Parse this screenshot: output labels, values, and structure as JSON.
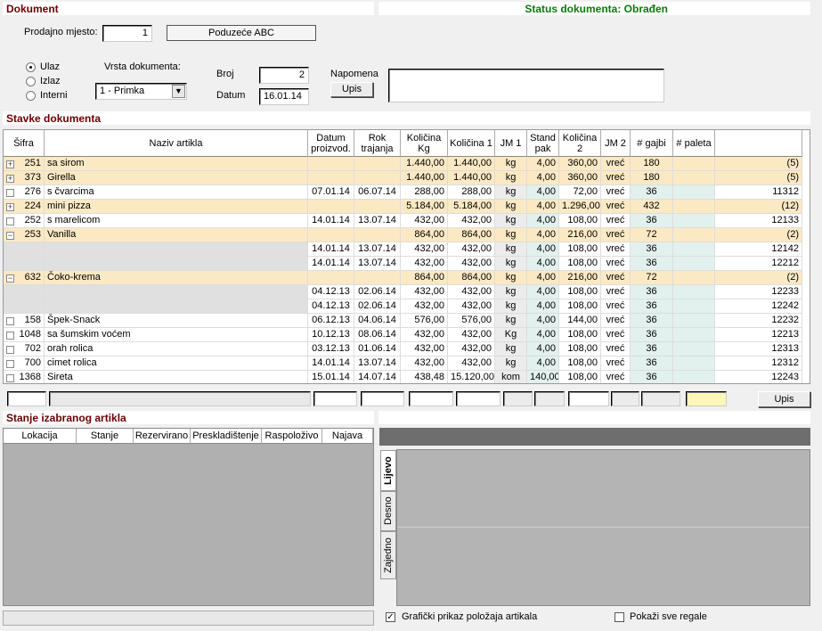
{
  "header": {
    "title": "Dokument",
    "status": "Status dokumenta: Obrađen"
  },
  "form": {
    "prodajno_mjesto_label": "Prodajno mjesto:",
    "prodajno_mjesto_value": "1",
    "company": "Poduzeće ABC",
    "direction": [
      "Ulaz",
      "Izlaz",
      "Interni"
    ],
    "direction_selected": "Ulaz",
    "vrsta_label": "Vrsta dokumenta:",
    "vrsta_value": "1 - Primka",
    "broj_label": "Broj",
    "broj_value": "2",
    "datum_label": "Datum",
    "datum_value": "16.01.14",
    "napomena_label": "Napomena",
    "upis_label": "Upis",
    "napomena_value": ""
  },
  "items_section": {
    "title": "Stavke dokumenta",
    "columns": [
      "Šifra",
      "Naziv artikla",
      "Datum proizvod.",
      "Rok trajanja",
      "Količina Kg",
      "Količina 1",
      "JM 1",
      "Stand pak",
      "Količina 2",
      "JM 2",
      "# gajbi",
      "# paleta",
      ""
    ],
    "rows": [
      {
        "kind": "group",
        "exp": "+",
        "sifra": "251",
        "naziv": "sa sirom",
        "dat": "",
        "rok": "",
        "kg": "1.440,00",
        "k1": "1.440,00",
        "jm1": "kg",
        "sp": "4,00",
        "k2": "360,00",
        "jm2": "vreć",
        "gaj": "180",
        "pal": "",
        "last": "(5)"
      },
      {
        "kind": "group",
        "exp": "+",
        "sifra": "373",
        "naziv": "Girella",
        "dat": "",
        "rok": "",
        "kg": "1.440,00",
        "k1": "1.440,00",
        "jm1": "kg",
        "sp": "4,00",
        "k2": "360,00",
        "jm2": "vreć",
        "gaj": "180",
        "pal": "",
        "last": "(5)"
      },
      {
        "kind": "item",
        "exp": "",
        "sifra": "276",
        "naziv": "s čvarcima",
        "dat": "07.01.14",
        "rok": "06.07.14",
        "kg": "288,00",
        "k1": "288,00",
        "jm1": "kg",
        "sp": "4,00",
        "k2": "72,00",
        "jm2": "vreć",
        "gaj": "36",
        "pal": "",
        "last": "11312"
      },
      {
        "kind": "group",
        "exp": "+",
        "sifra": "224",
        "naziv": "mini pizza",
        "dat": "",
        "rok": "",
        "kg": "5.184,00",
        "k1": "5.184,00",
        "jm1": "kg",
        "sp": "4,00",
        "k2": "1.296,00",
        "jm2": "vreć",
        "gaj": "432",
        "pal": "",
        "last": "(12)"
      },
      {
        "kind": "item",
        "exp": "",
        "sifra": "252",
        "naziv": "s marelicom",
        "dat": "14.01.14",
        "rok": "13.07.14",
        "kg": "432,00",
        "k1": "432,00",
        "jm1": "kg",
        "sp": "4,00",
        "k2": "108,00",
        "jm2": "vreć",
        "gaj": "36",
        "pal": "",
        "last": "12133"
      },
      {
        "kind": "group",
        "exp": "−",
        "sifra": "253",
        "naziv": "Vanilla",
        "dat": "",
        "rok": "",
        "kg": "864,00",
        "k1": "864,00",
        "jm1": "kg",
        "sp": "4,00",
        "k2": "216,00",
        "jm2": "vreć",
        "gaj": "72",
        "pal": "",
        "last": "(2)"
      },
      {
        "kind": "sub",
        "exp": "",
        "sifra": "",
        "naziv": "",
        "dat": "14.01.14",
        "rok": "13.07.14",
        "kg": "432,00",
        "k1": "432,00",
        "jm1": "kg",
        "sp": "4,00",
        "k2": "108,00",
        "jm2": "vreć",
        "gaj": "36",
        "pal": "",
        "last": "12142"
      },
      {
        "kind": "sub",
        "exp": "",
        "sifra": "",
        "naziv": "",
        "dat": "14.01.14",
        "rok": "13.07.14",
        "kg": "432,00",
        "k1": "432,00",
        "jm1": "kg",
        "sp": "4,00",
        "k2": "108,00",
        "jm2": "vreć",
        "gaj": "36",
        "pal": "",
        "last": "12212"
      },
      {
        "kind": "group",
        "exp": "−",
        "sifra": "632",
        "naziv": "Čoko-krema",
        "dat": "",
        "rok": "",
        "kg": "864,00",
        "k1": "864,00",
        "jm1": "kg",
        "sp": "4,00",
        "k2": "216,00",
        "jm2": "vreć",
        "gaj": "72",
        "pal": "",
        "last": "(2)"
      },
      {
        "kind": "sub",
        "exp": "",
        "sifra": "",
        "naziv": "",
        "dat": "04.12.13",
        "rok": "02.06.14",
        "kg": "432,00",
        "k1": "432,00",
        "jm1": "kg",
        "sp": "4,00",
        "k2": "108,00",
        "jm2": "vreć",
        "gaj": "36",
        "pal": "",
        "last": "12233"
      },
      {
        "kind": "sub",
        "exp": "",
        "sifra": "",
        "naziv": "",
        "dat": "04.12.13",
        "rok": "02.06.14",
        "kg": "432,00",
        "k1": "432,00",
        "jm1": "kg",
        "sp": "4,00",
        "k2": "108,00",
        "jm2": "vreć",
        "gaj": "36",
        "pal": "",
        "last": "12242"
      },
      {
        "kind": "item",
        "exp": "",
        "sifra": "158",
        "naziv": "Špek-Snack",
        "dat": "06.12.13",
        "rok": "04.06.14",
        "kg": "576,00",
        "k1": "576,00",
        "jm1": "kg",
        "sp": "4,00",
        "k2": "144,00",
        "jm2": "vreć",
        "gaj": "36",
        "pal": "",
        "last": "12232"
      },
      {
        "kind": "item",
        "exp": "",
        "sifra": "1048",
        "naziv": "sa šumskim voćem",
        "dat": "10.12.13",
        "rok": "08.06.14",
        "kg": "432,00",
        "k1": "432,00",
        "jm1": "Kg",
        "sp": "4,00",
        "k2": "108,00",
        "jm2": "vreć",
        "gaj": "36",
        "pal": "",
        "last": "12213"
      },
      {
        "kind": "item",
        "exp": "",
        "sifra": "702",
        "naziv": "orah rolica",
        "dat": "03.12.13",
        "rok": "01.06.14",
        "kg": "432,00",
        "k1": "432,00",
        "jm1": "kg",
        "sp": "4,00",
        "k2": "108,00",
        "jm2": "vreć",
        "gaj": "36",
        "pal": "",
        "last": "12313"
      },
      {
        "kind": "item",
        "exp": "",
        "sifra": "700",
        "naziv": "cimet rolica",
        "dat": "14.01.14",
        "rok": "13.07.14",
        "kg": "432,00",
        "k1": "432,00",
        "jm1": "kg",
        "sp": "4,00",
        "k2": "108,00",
        "jm2": "vreć",
        "gaj": "36",
        "pal": "",
        "last": "12312"
      },
      {
        "kind": "item",
        "exp": "",
        "sifra": "1368",
        "naziv": "Sireta",
        "dat": "15.01.14",
        "rok": "14.07.14",
        "kg": "438,48",
        "k1": "15.120,00",
        "jm1": "kom",
        "sp": "140,00",
        "k2": "108,00",
        "jm2": "vreć",
        "gaj": "36",
        "pal": "",
        "last": "12243"
      }
    ],
    "entry_upis": "Upis"
  },
  "stock_section": {
    "title": "Stanje izabranog artikla",
    "columns": [
      "Lokacija",
      "Stanje",
      "Rezervirano",
      "Preskladištenje",
      "Raspoloživo",
      "Najava"
    ]
  },
  "rack_panel": {
    "tabs": [
      "Lijevo",
      "Desno",
      "Zajedno"
    ],
    "graphic_label": "Grafički prikaz položaja artikala",
    "show_all_label": "Pokaži sve regale"
  }
}
